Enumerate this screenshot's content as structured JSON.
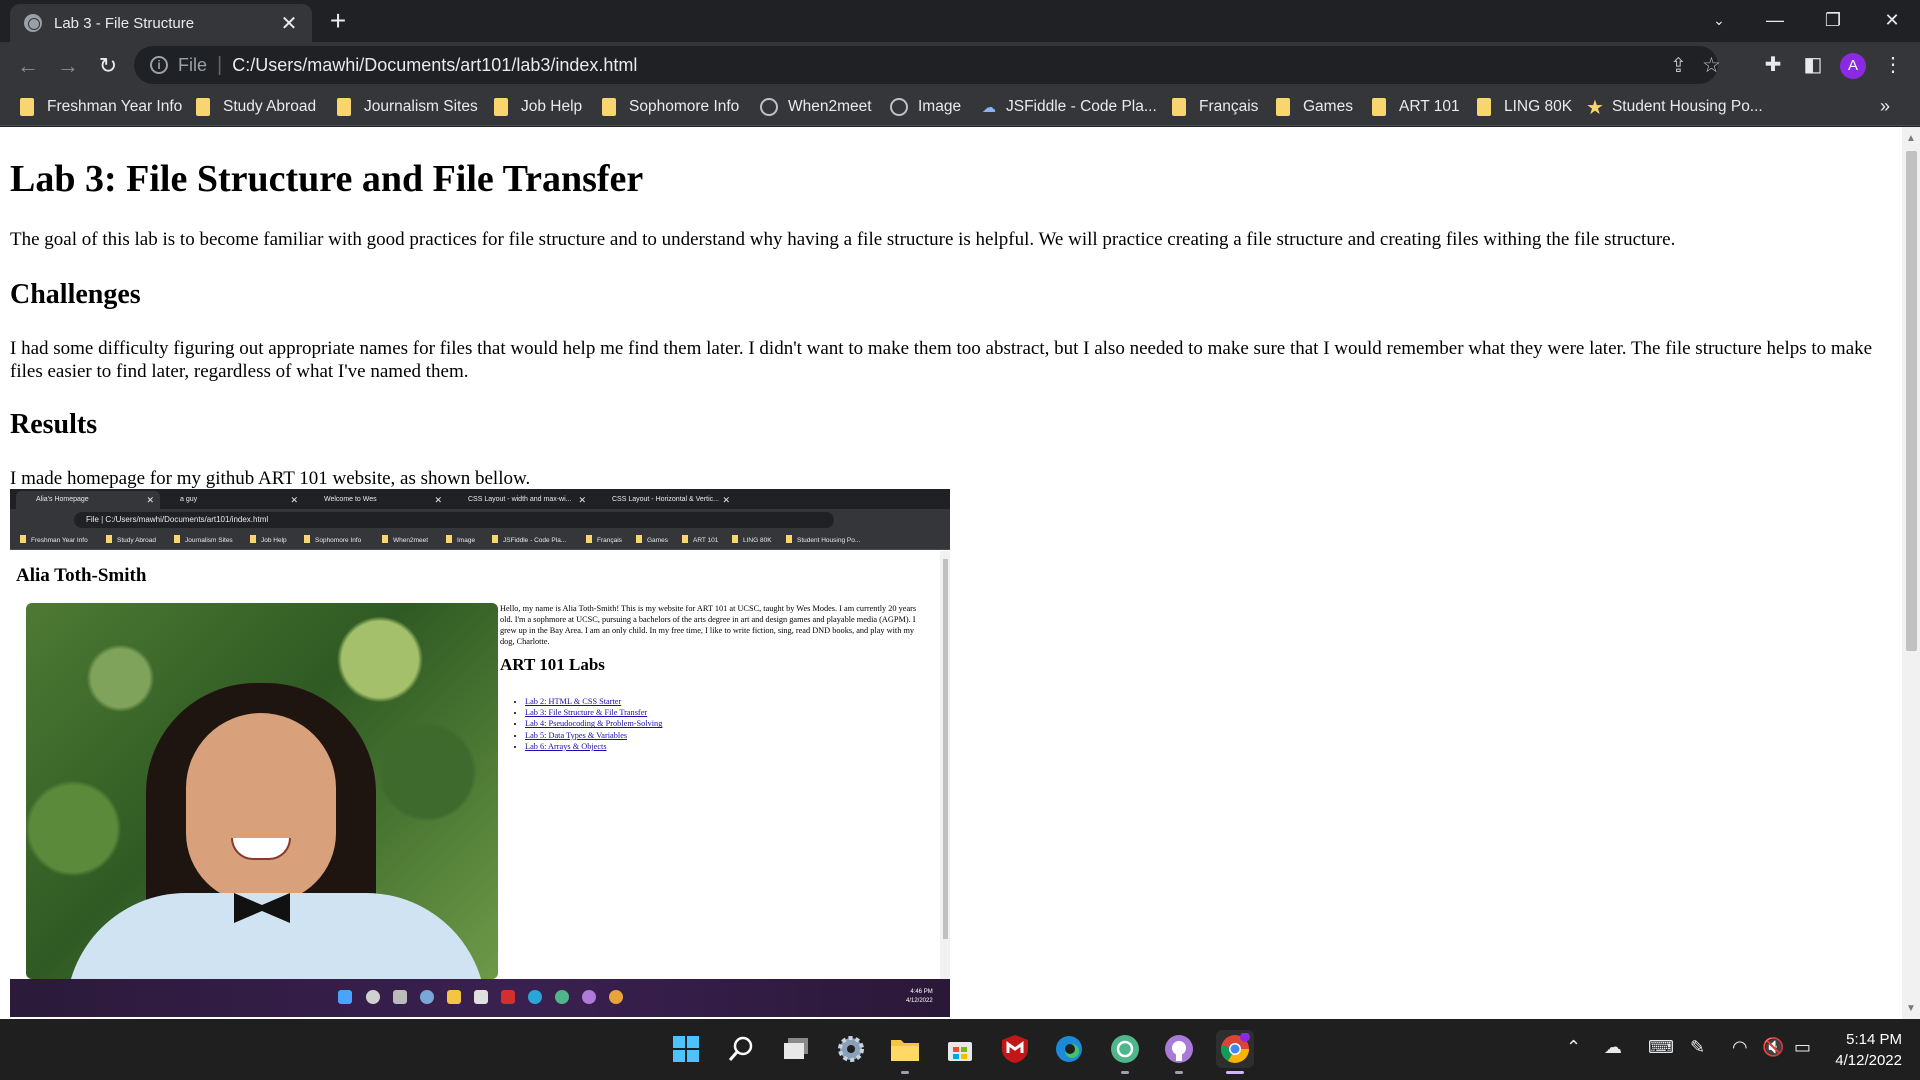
{
  "tab": {
    "title": "Lab 3 - File Structure",
    "close": "✕",
    "new": "+"
  },
  "window": {
    "minimize": "—",
    "restore": "❐",
    "close": "✕",
    "tab_search": "⌄"
  },
  "omnibox": {
    "scheme": "File",
    "url": "C:/Users/mawhi/Documents/art101/lab3/index.html"
  },
  "profile": {
    "initial": "A"
  },
  "bookmarks": [
    {
      "label": "Freshman Year Info",
      "icon": "folder-icon"
    },
    {
      "label": "Study Abroad",
      "icon": "folder-icon"
    },
    {
      "label": "Journalism Sites",
      "icon": "folder-icon"
    },
    {
      "label": "Job Help",
      "icon": "folder-icon"
    },
    {
      "label": "Sophomore Info",
      "icon": "folder-icon"
    },
    {
      "label": "When2meet",
      "icon": "clock-icon"
    },
    {
      "label": "Image",
      "icon": "globe-icon"
    },
    {
      "label": "JSFiddle - Code Pla...",
      "icon": "cloud-icon"
    },
    {
      "label": "Français",
      "icon": "folder-icon"
    },
    {
      "label": "Games",
      "icon": "folder-icon"
    },
    {
      "label": "ART 101",
      "icon": "folder-icon"
    },
    {
      "label": "LING 80K",
      "icon": "folder-icon"
    },
    {
      "label": "Student Housing Po...",
      "icon": "star-icon"
    }
  ],
  "bookmarks_more": "»",
  "page": {
    "title": "Lab 3: File Structure and File Transfer",
    "intro": "The goal of this lab is to become familiar with good practices for file structure and to understand why having a file structure is helpful. We will practice creating a file structure and creating files withing the file structure.",
    "challenges_heading": "Challenges",
    "challenges_text": "I had some difficulty figuring out appropriate names for files that would help me find them later. I didn't want to make them too abstract, but I also needed to make sure that I would remember what they were later. The file structure helps to make files easier to find later, regardless of what I've named them.",
    "results_heading": "Results",
    "results_text": "I made homepage for my github ART 101 website, as shown bellow."
  },
  "screenshot": {
    "tabs": [
      "Alia's Homepage",
      "a guy",
      "Welcome to Wes",
      "CSS Layout - width and max-wi...",
      "CSS Layout - Horizontal & Vertic..."
    ],
    "url": "File | C:/Users/mawhi/Documents/art101/index.html",
    "bookmarks": [
      "Freshman Year Info",
      "Study Abroad",
      "Journalism Sites",
      "Job Help",
      "Sophomore Info",
      "When2meet",
      "Image",
      "JSFiddle - Code Pla...",
      "Français",
      "Games",
      "ART 101",
      "LING 80K",
      "Student Housing Po..."
    ],
    "name": "Alia Toth-Smith",
    "bio": "Hello, my name is Alia Toth-Smith! This is my website for ART 101 at UCSC, taught by Wes Modes. I am currently 20 years old. I'm a sophmore at UCSC, pursuing a bachelors of the arts degree in art and design games and playable media (AGPM). I grew up in the Bay Area. I am an only child. In my free time, I like to write fiction, sing, read DND books, and play with my dog, Charlotte.",
    "labs_heading": "ART 101 Labs",
    "labs": [
      "Lab 2: HTML & CSS Starter",
      "Lab 3: File Structure & File Transfer",
      "Lab 4: Pseudocoding & Problem-Solving",
      "Lab 5: Data Types & Variables",
      "Lab 6: Arrays & Objects"
    ],
    "time": "4:46 PM",
    "date": "4/12/2022"
  },
  "taskbar": {
    "apps": [
      "start-icon",
      "search-icon",
      "task-view-icon",
      "settings-icon",
      "file-explorer-icon",
      "microsoft-store-icon",
      "mcafee-icon",
      "edge-icon",
      "chatgpt-icon",
      "github-icon",
      "chrome-icon"
    ],
    "time": "5:14 PM",
    "date": "4/12/2022"
  }
}
